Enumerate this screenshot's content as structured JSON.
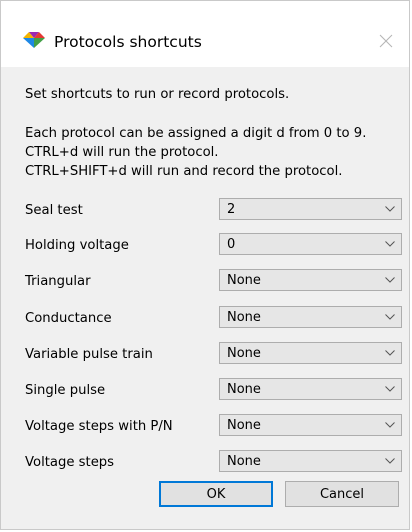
{
  "window": {
    "title": "Protocols shortcuts",
    "icon": "app-icon",
    "close_icon": "close-icon"
  },
  "description": {
    "line1": "Set shortcuts to run or record protocols.",
    "line2": "Each protocol can be assigned a digit d from 0 to 9.",
    "line3": "CTRL+d will run the protocol.",
    "line4": "CTRL+SHIFT+d will run and record the protocol."
  },
  "rows": [
    {
      "label": "Seal test",
      "value": "2"
    },
    {
      "label": "Holding voltage",
      "value": "0"
    },
    {
      "label": "Triangular",
      "value": "None"
    },
    {
      "label": "Conductance",
      "value": "None"
    },
    {
      "label": "Variable pulse train",
      "value": "None"
    },
    {
      "label": "Single pulse",
      "value": "None"
    },
    {
      "label": "Voltage steps with P/N",
      "value": "None"
    },
    {
      "label": "Voltage steps",
      "value": "None"
    }
  ],
  "buttons": {
    "ok": "OK",
    "cancel": "Cancel"
  },
  "colors": {
    "accent": "#0078d7",
    "dialog_bg": "#f0f0f0"
  }
}
